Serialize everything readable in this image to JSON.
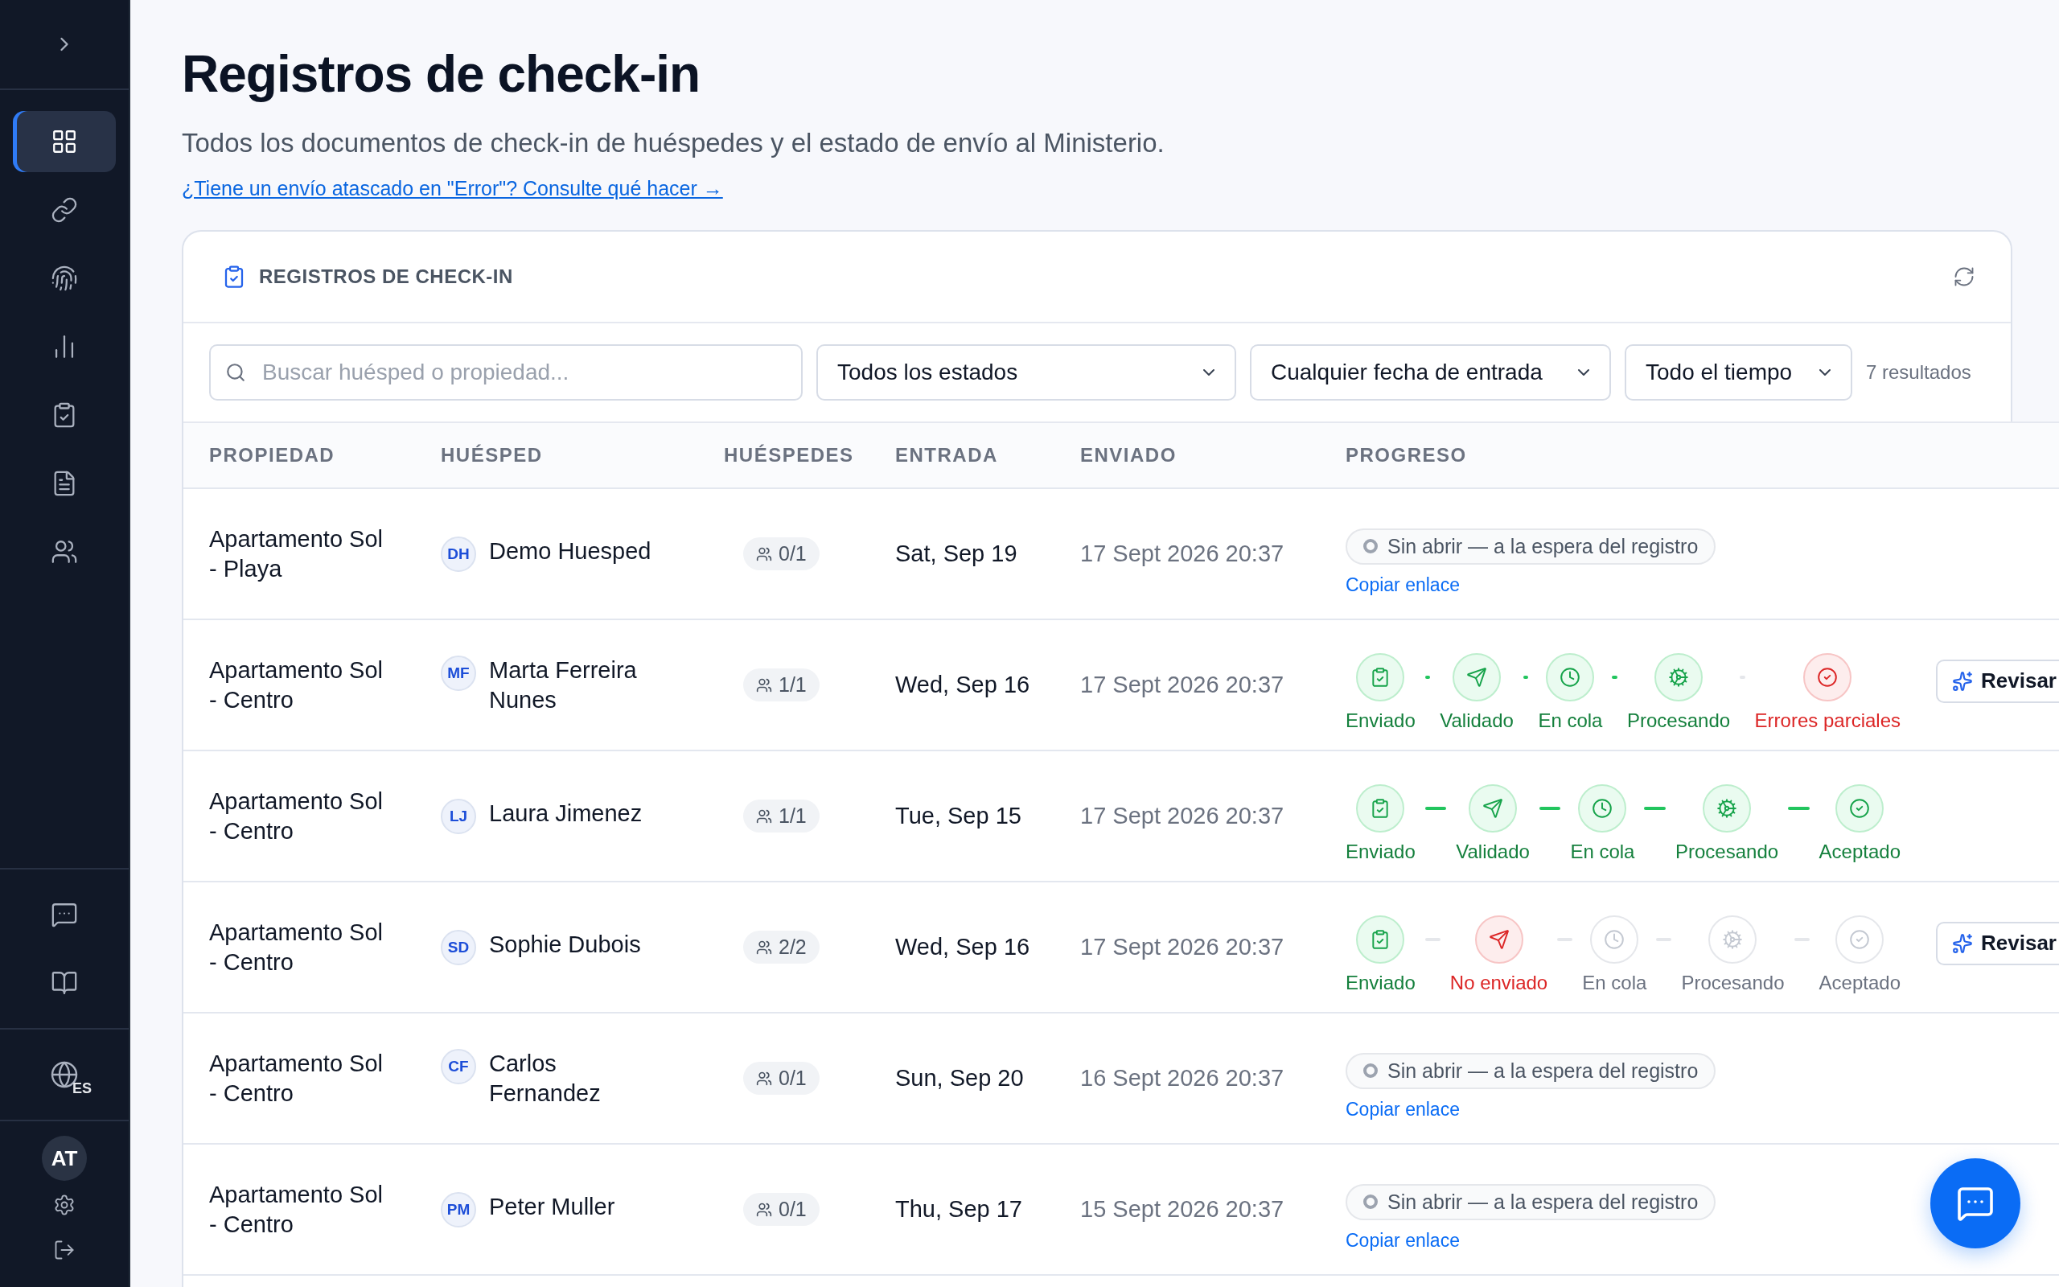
{
  "sidebar": {
    "nav": [
      {
        "selected": true
      },
      {
        "selected": false
      },
      {
        "selected": false
      },
      {
        "selected": false
      },
      {
        "selected": false
      },
      {
        "selected": false
      },
      {
        "selected": false
      }
    ],
    "language": "ES",
    "user_initials": "AT"
  },
  "page": {
    "title": "Registros de check-in",
    "subtitle": "Todos los documentos de check-in de huéspedes y el estado de envío al Ministerio.",
    "help_link": "¿Tiene un envío atascado en \"Error\"? Consulte qué hacer →"
  },
  "card": {
    "title": "REGISTROS DE CHECK-IN"
  },
  "filters": {
    "search": {
      "placeholder": "Buscar huésped o propiedad..."
    },
    "selects": [
      "Todos los estados",
      "Cualquier fecha de entrada",
      "Todo el tiempo"
    ],
    "result_count": "7 resultados"
  },
  "table": {
    "columns": [
      "PROPIEDAD",
      "HUÉSPED",
      "HUÉSPEDES",
      "ENTRADA",
      "ENVIADO",
      "PROGRESO"
    ],
    "rows": [
      {
        "property": "Apartamento Sol - Playa",
        "initials": "DH",
        "guest": "Demo Huesped",
        "guests": "0/1",
        "checkin": "Sat, Sep 19",
        "sent": "17 Sept 2026 20:37",
        "progress": {
          "kind": "pending",
          "status": "Sin abrir — a la espera del registro",
          "link": "Copiar enlace"
        }
      },
      {
        "property": "Apartamento Sol - Centro",
        "initials": "MF",
        "guest": "Marta Ferreira Nunes",
        "guests": "1/1",
        "checkin": "Wed, Sep 16",
        "sent": "17 Sept 2026 20:37",
        "progress": {
          "kind": "steps",
          "steps": [
            {
              "label": "Enviado",
              "kind": "done"
            },
            {
              "label": "Validado",
              "kind": "done"
            },
            {
              "label": "En cola",
              "kind": "done"
            },
            {
              "label": "Procesando",
              "kind": "done"
            },
            {
              "label": "Errores parciales",
              "kind": "error"
            }
          ],
          "action": "Revisar"
        }
      },
      {
        "property": "Apartamento Sol - Centro",
        "initials": "LJ",
        "guest": "Laura Jimenez",
        "guests": "1/1",
        "checkin": "Tue, Sep 15",
        "sent": "17 Sept 2026 20:37",
        "progress": {
          "kind": "steps",
          "steps": [
            {
              "label": "Enviado",
              "kind": "done"
            },
            {
              "label": "Validado",
              "kind": "done"
            },
            {
              "label": "En cola",
              "kind": "done"
            },
            {
              "label": "Procesando",
              "kind": "done"
            },
            {
              "label": "Aceptado",
              "kind": "done"
            }
          ]
        }
      },
      {
        "property": "Apartamento Sol - Centro",
        "initials": "SD",
        "guest": "Sophie Dubois",
        "guests": "2/2",
        "checkin": "Wed, Sep 16",
        "sent": "17 Sept 2026 20:37",
        "progress": {
          "kind": "steps",
          "steps": [
            {
              "label": "Enviado",
              "kind": "done"
            },
            {
              "label": "No enviado",
              "kind": "error"
            },
            {
              "label": "En cola",
              "kind": "inactive"
            },
            {
              "label": "Procesando",
              "kind": "inactive"
            },
            {
              "label": "Aceptado",
              "kind": "inactive"
            }
          ],
          "action": "Revisar"
        }
      },
      {
        "property": "Apartamento Sol - Centro",
        "initials": "CF",
        "guest": "Carlos Fernandez",
        "guests": "0/1",
        "checkin": "Sun, Sep 20",
        "sent": "16 Sept 2026 20:37",
        "progress": {
          "kind": "pending",
          "status": "Sin abrir — a la espera del registro",
          "link": "Copiar enlace"
        }
      },
      {
        "property": "Apartamento Sol - Centro",
        "initials": "PM",
        "guest": "Peter Muller",
        "guests": "0/1",
        "checkin": "Thu, Sep 17",
        "sent": "15 Sept 2026 20:37",
        "progress": {
          "kind": "pending",
          "status": "Sin abrir — a la espera del registro",
          "link": "Copiar enlace"
        }
      }
    ]
  }
}
